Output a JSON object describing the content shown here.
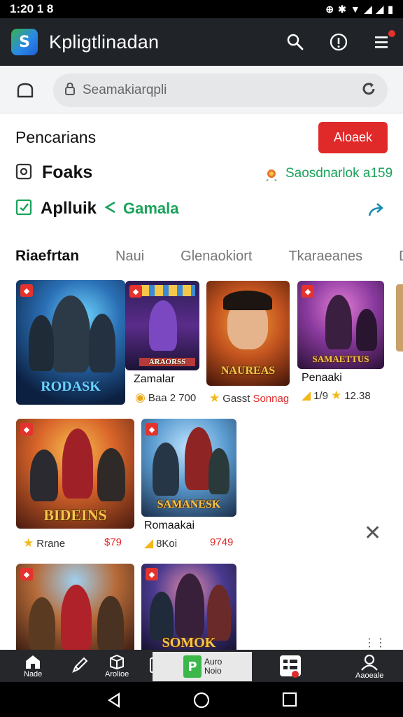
{
  "status": {
    "time": "1:20 1 8"
  },
  "app": {
    "title": "Kpligtlinadan",
    "logo_letter": "S"
  },
  "search": {
    "placeholder": "Seamakiarqpli"
  },
  "header": {
    "section_title": "Pencarians",
    "alert_button": "Aloaek"
  },
  "row1": {
    "label": "Foaks",
    "link": "Saosdnarlok a159"
  },
  "row2": {
    "label": "Aplluik",
    "games_label": "Gamala"
  },
  "tabs": [
    "Riaefrtan",
    "Naui",
    "Glenaokiort",
    "Tkaraeanes",
    "D"
  ],
  "cards": [
    {
      "cover_text": "RODASK",
      "caption": "",
      "rating": "",
      "price": ""
    },
    {
      "cover_text": "ARAORSS",
      "caption": "Zamalar",
      "rating": "Baa 2 700",
      "price": ""
    },
    {
      "cover_text": "NAUREAS",
      "caption": "",
      "rating": "Gasst",
      "price": "Sonnag"
    },
    {
      "cover_text": "SAMAETTUS",
      "caption": "Penaaki",
      "rating": "1/9",
      "price": "12.38"
    },
    {
      "cover_text": "BIDEINS",
      "caption": "",
      "rating": "Rrane",
      "price": "$79"
    },
    {
      "cover_text": "SAMANESK",
      "caption": "Romaakai",
      "rating": "8Koi",
      "price": "9749"
    },
    {
      "cover_text": "",
      "caption": "",
      "rating": "",
      "price": ""
    },
    {
      "cover_text": "SOMOK",
      "caption": "",
      "rating": "",
      "price": ""
    }
  ],
  "bottom_nav": {
    "home": "Nade",
    "item2": "",
    "item3": "Arolioe",
    "pill_title": "Auro",
    "pill_sub": "Noio",
    "profile": "Aaoeale"
  },
  "colors": {
    "accent_green": "#1aa35a",
    "alert_red": "#e02a2a",
    "appbar": "#202328"
  }
}
